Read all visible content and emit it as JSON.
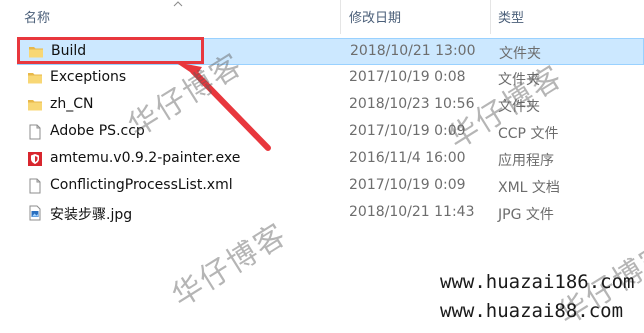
{
  "header": {
    "name_label": "名称",
    "date_label": "修改日期",
    "type_label": "类型"
  },
  "files": [
    {
      "name": "Build",
      "date": "2018/10/21 13:00",
      "type": "文件夹",
      "icon": "folder-icon",
      "selected": true
    },
    {
      "name": "Exceptions",
      "date": "2017/10/19 0:08",
      "type": "文件夹",
      "icon": "folder-icon"
    },
    {
      "name": "zh_CN",
      "date": "2018/10/23 10:56",
      "type": "文件夹",
      "icon": "folder-icon"
    },
    {
      "name": "Adobe PS.ccp",
      "date": "2017/10/19 0:09",
      "type": "CCP 文件",
      "icon": "file-icon"
    },
    {
      "name": "amtemu.v0.9.2-painter.exe",
      "date": "2016/11/4 16:00",
      "type": "应用程序",
      "icon": "shield-app-icon"
    },
    {
      "name": "ConflictingProcessList.xml",
      "date": "2017/10/19 0:09",
      "type": "XML 文档",
      "icon": "file-icon"
    },
    {
      "name": "安装步骤.jpg",
      "date": "2018/10/21 11:43",
      "type": "JPG 文件",
      "icon": "image-file-icon"
    }
  ],
  "watermark": {
    "text": "华仔博客",
    "url1": "www.huazai186.com",
    "url2": "www.huazai88.com"
  },
  "colors": {
    "selection_bg": "#cce8ff",
    "highlight_red": "#e8373d",
    "folder_yellow": "#f8d775"
  }
}
